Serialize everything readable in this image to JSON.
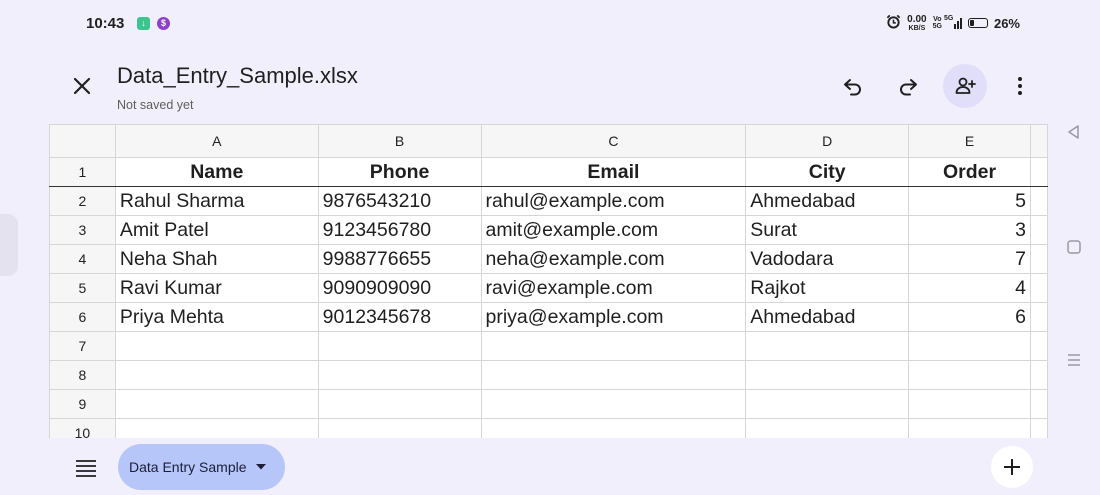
{
  "status": {
    "time": "10:43",
    "net_speed": "0.00",
    "net_unit": "KB/S",
    "volte": "Vo",
    "volte_sub": "5G",
    "signal": "5G",
    "battery": "26%",
    "battery_level": 0.26
  },
  "header": {
    "title": "Data_Entry_Sample.xlsx",
    "subtitle": "Not saved yet"
  },
  "sheet": {
    "columns": [
      "A",
      "B",
      "C",
      "D",
      "E"
    ],
    "rows": [
      {
        "num": "1",
        "cells": [
          "Name",
          "Phone",
          "Email",
          "City",
          "Order"
        ]
      },
      {
        "num": "2",
        "cells": [
          "Rahul Sharma",
          "9876543210",
          "rahul@example.com",
          "Ahmedabad",
          "5"
        ]
      },
      {
        "num": "3",
        "cells": [
          "Amit Patel",
          "9123456780",
          "amit@example.com",
          "Surat",
          "3"
        ]
      },
      {
        "num": "4",
        "cells": [
          "Neha Shah",
          "9988776655",
          "neha@example.com",
          "Vadodara",
          "7"
        ]
      },
      {
        "num": "5",
        "cells": [
          "Ravi Kumar",
          "9090909090",
          "ravi@example.com",
          "Rajkot",
          "4"
        ]
      },
      {
        "num": "6",
        "cells": [
          "Priya Mehta",
          "9012345678",
          "priya@example.com",
          "Ahmedabad",
          "6"
        ]
      },
      {
        "num": "7",
        "cells": [
          "",
          "",
          "",
          "",
          ""
        ]
      },
      {
        "num": "8",
        "cells": [
          "",
          "",
          "",
          "",
          ""
        ]
      },
      {
        "num": "9",
        "cells": [
          "",
          "",
          "",
          "",
          ""
        ]
      },
      {
        "num": "10",
        "cells": [
          "",
          "",
          "",
          "",
          ""
        ]
      }
    ]
  },
  "bottom": {
    "sheet_tab": "Data Entry Sample"
  },
  "colors": {
    "background": "#f1effb",
    "tab_active": "#b6c6f8",
    "share_bg": "#e1defa"
  }
}
